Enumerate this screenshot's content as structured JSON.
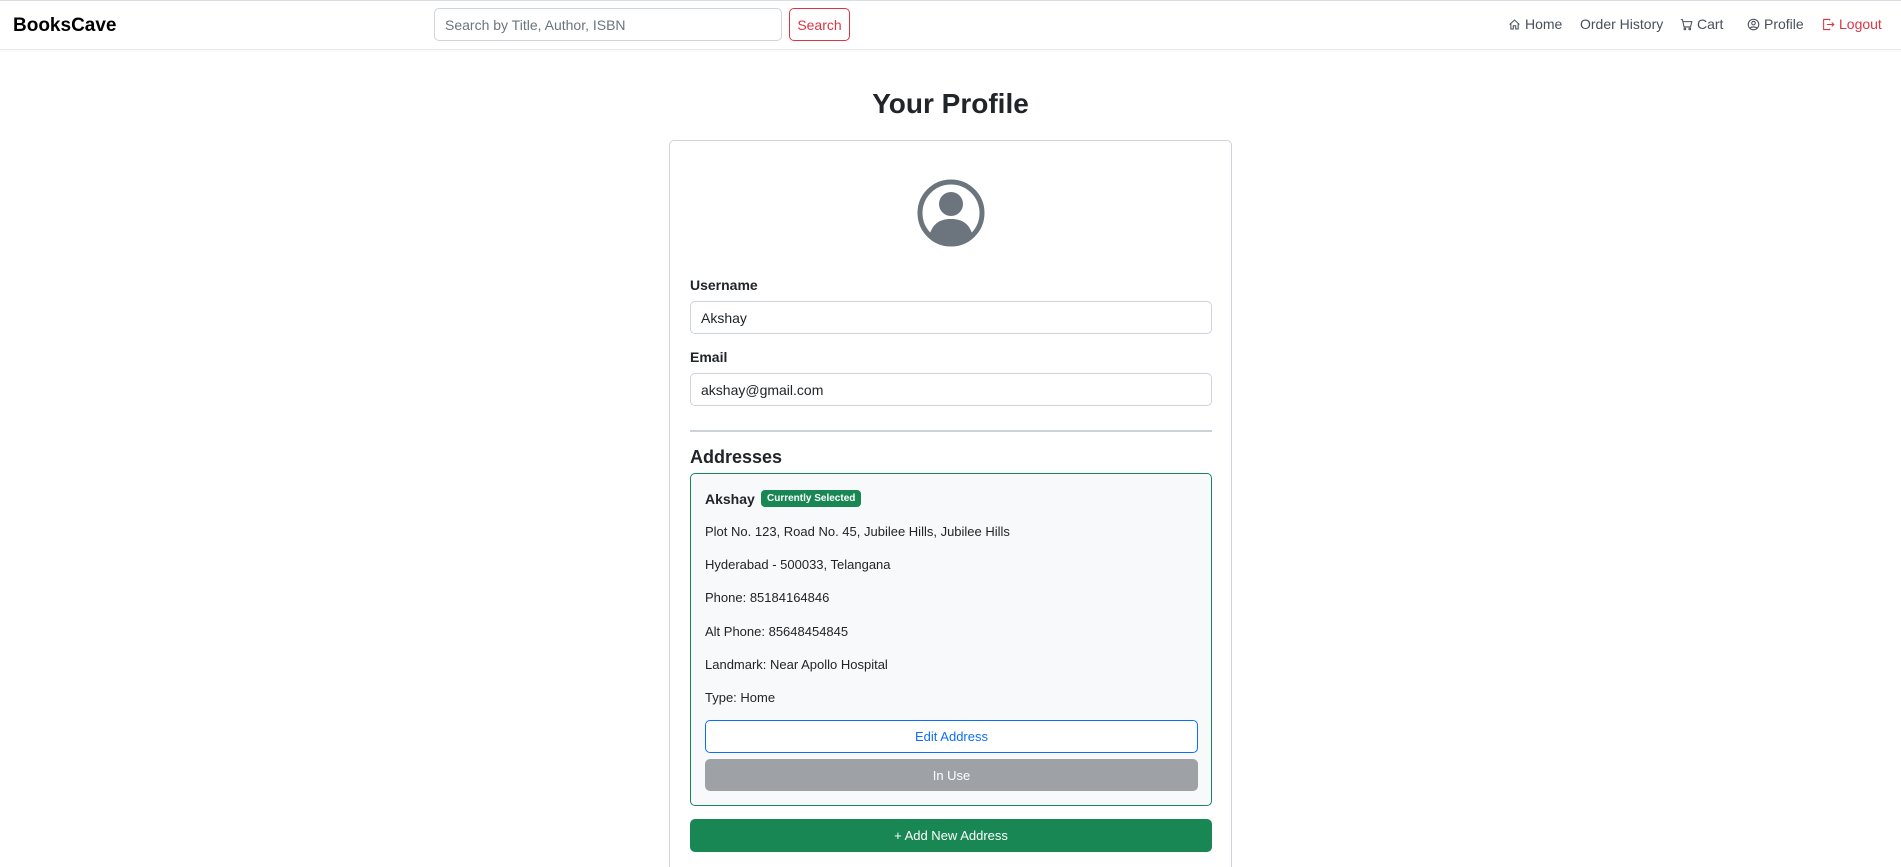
{
  "header": {
    "brand": "BooksCave",
    "search_placeholder": "Search by Title, Author, ISBN",
    "search_button": "Search",
    "nav": {
      "home": "Home",
      "order_history": "Order History",
      "cart": "Cart",
      "profile": "Profile",
      "logout": "Logout"
    }
  },
  "main": {
    "title": "Your Profile",
    "username_label": "Username",
    "username_value": "Akshay",
    "email_label": "Email",
    "email_value": "akshay@gmail.com",
    "addresses_heading": "Addresses",
    "address": {
      "name": "Akshay",
      "badge": "Currently Selected",
      "line1": "Plot No. 123, Road No. 45, Jubilee Hills, Jubilee Hills",
      "line2": "Hyderabad - 500033, Telangana",
      "phone": "Phone: 85184164846",
      "alt_phone": "Alt Phone: 85648454845",
      "landmark": "Landmark: Near Apollo Hospital",
      "type": "Type: Home",
      "edit_button": "Edit Address",
      "in_use_button": "In Use"
    },
    "add_address_button": "+ Add New Address"
  },
  "colors": {
    "primary": "#0d6efd",
    "success": "#198754",
    "danger": "#dc3545",
    "secondary": "#9ea2a6"
  },
  "icons": [
    "house-icon",
    "cart-icon",
    "person-circle-icon",
    "logout-icon",
    "avatar-icon"
  ]
}
